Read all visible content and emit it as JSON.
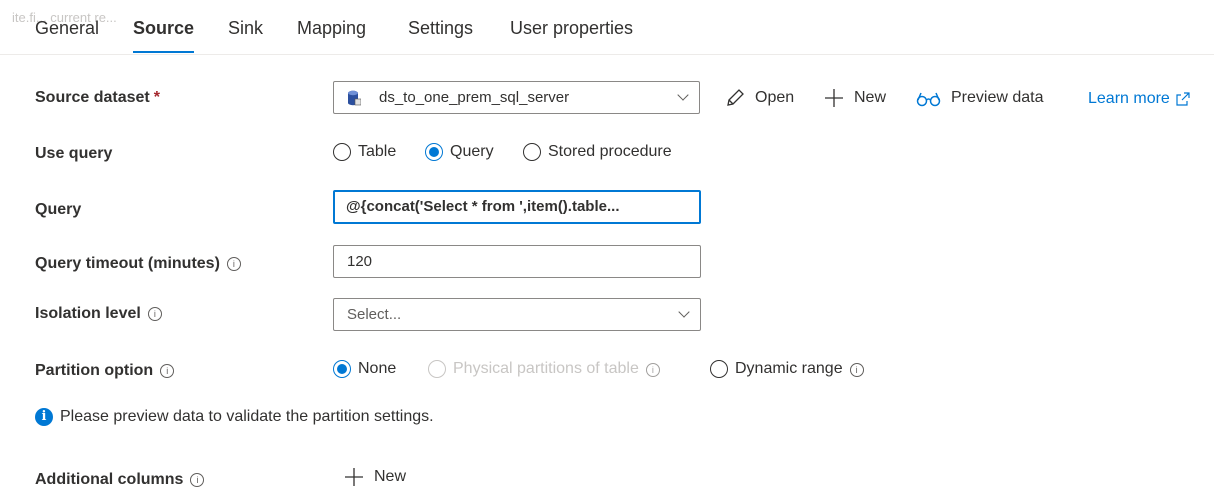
{
  "faint_text": "ite.fi... current re... ",
  "tabs": [
    {
      "label": "General"
    },
    {
      "label": "Source",
      "active": true
    },
    {
      "label": "Sink"
    },
    {
      "label": "Mapping"
    },
    {
      "label": "Settings"
    },
    {
      "label": "User properties"
    }
  ],
  "source_dataset": {
    "label": "Source dataset",
    "required": "*",
    "value": "ds_to_one_prem_sql_server",
    "actions": {
      "open": "Open",
      "new": "New",
      "preview": "Preview data"
    },
    "learn_more": "Learn more"
  },
  "use_query": {
    "label": "Use query",
    "options": [
      "Table",
      "Query",
      "Stored procedure"
    ],
    "selected": "Query"
  },
  "query": {
    "label": "Query",
    "value": "@{concat('Select * from ',item().table..."
  },
  "query_timeout": {
    "label": "Query timeout (minutes)",
    "value": "120"
  },
  "isolation_level": {
    "label": "Isolation level",
    "placeholder": "Select..."
  },
  "partition_option": {
    "label": "Partition option",
    "options": [
      "None",
      "Physical partitions of table",
      "Dynamic range"
    ],
    "selected": "None",
    "disabled": "Physical partitions of table"
  },
  "info_note": "Please preview data to validate the partition settings.",
  "additional_columns": {
    "label": "Additional columns",
    "new": "New"
  },
  "colors": {
    "accent": "#0078d4",
    "required": "#a4262c",
    "disabled": "#c8c6c4"
  }
}
